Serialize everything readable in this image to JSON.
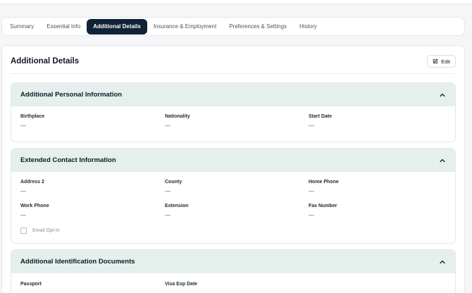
{
  "tabs": [
    {
      "label": "Summary"
    },
    {
      "label": "Essential Info"
    },
    {
      "label": "Additional Details"
    },
    {
      "label": "Insurance & Employment"
    },
    {
      "label": "Preferences & Settings"
    },
    {
      "label": "History"
    }
  ],
  "active_tab": "Additional Details",
  "card": {
    "title": "Additional Details",
    "edit_label": "Edit"
  },
  "sections": {
    "personal": {
      "title": "Additional Personal Information",
      "fields": [
        {
          "label": "Birthplace",
          "value": "—"
        },
        {
          "label": "Nationality",
          "value": "—"
        },
        {
          "label": "Start Date",
          "value": "—"
        }
      ]
    },
    "contact": {
      "title": "Extended Contact Information",
      "fields": [
        {
          "label": "Address 2",
          "value": "—"
        },
        {
          "label": "County",
          "value": "—"
        },
        {
          "label": "Home Phone",
          "value": "—"
        },
        {
          "label": "Work Phone",
          "value": "—"
        },
        {
          "label": "Extension",
          "value": "—"
        },
        {
          "label": "Fax Number",
          "value": "—"
        }
      ],
      "email_opt_in_label": "Email Opt-In",
      "email_opt_in_checked": false
    },
    "identification": {
      "title": "Additional Identification Documents",
      "fields": [
        {
          "label": "Passport"
        },
        {
          "label": "Visa Exp Date"
        }
      ]
    }
  },
  "icons": {
    "edit": "edit-icon",
    "collapse": "chevron-up-icon"
  },
  "colors": {
    "active_tab_bg": "#0f2237",
    "section_header_bg": "#e5efec"
  }
}
